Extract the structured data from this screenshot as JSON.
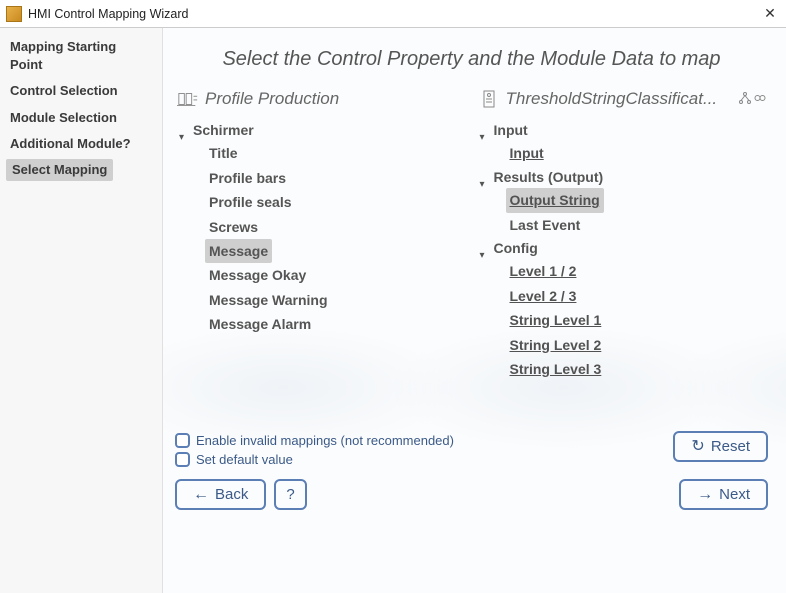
{
  "window": {
    "title": "HMI Control Mapping Wizard"
  },
  "sidebar": {
    "steps": [
      {
        "label": "Mapping Starting Point",
        "selected": false
      },
      {
        "label": "Control Selection",
        "selected": false
      },
      {
        "label": "Module Selection",
        "selected": false
      },
      {
        "label": "Additional Module?",
        "selected": false
      },
      {
        "label": "Select Mapping",
        "selected": true
      }
    ]
  },
  "page": {
    "title": "Select the Control Property and the Module Data to map"
  },
  "left": {
    "header": "Profile Production",
    "root": {
      "label": "Schirmer",
      "children": [
        {
          "label": "Title",
          "selected": false
        },
        {
          "label": "Profile bars",
          "selected": false
        },
        {
          "label": "Profile seals",
          "selected": false
        },
        {
          "label": "Screws",
          "selected": false
        },
        {
          "label": "Message",
          "selected": true
        },
        {
          "label": "Message Okay",
          "selected": false
        },
        {
          "label": "Message Warning",
          "selected": false
        },
        {
          "label": "Message Alarm",
          "selected": false
        }
      ]
    }
  },
  "right": {
    "header": "ThresholdStringClassificat...",
    "groups": [
      {
        "label": "Input",
        "items": [
          {
            "label": "Input",
            "underline": true
          }
        ]
      },
      {
        "label": "Results (Output)",
        "items": [
          {
            "label": "Output String",
            "underline": true,
            "selected": true
          },
          {
            "label": "Last Event",
            "underline": false
          }
        ]
      },
      {
        "label": "Config",
        "items": [
          {
            "label": "Level 1 / 2",
            "underline": true
          },
          {
            "label": "Level 2 / 3",
            "underline": true
          },
          {
            "label": "String Level 1",
            "underline": true
          },
          {
            "label": "String Level 2",
            "underline": true
          },
          {
            "label": "String Level 3",
            "underline": true
          }
        ]
      }
    ]
  },
  "options": {
    "enable_invalid": "Enable invalid mappings (not recommended)",
    "set_default": "Set default value"
  },
  "buttons": {
    "reset": "Reset",
    "back": "Back",
    "help": "?",
    "next": "Next"
  }
}
